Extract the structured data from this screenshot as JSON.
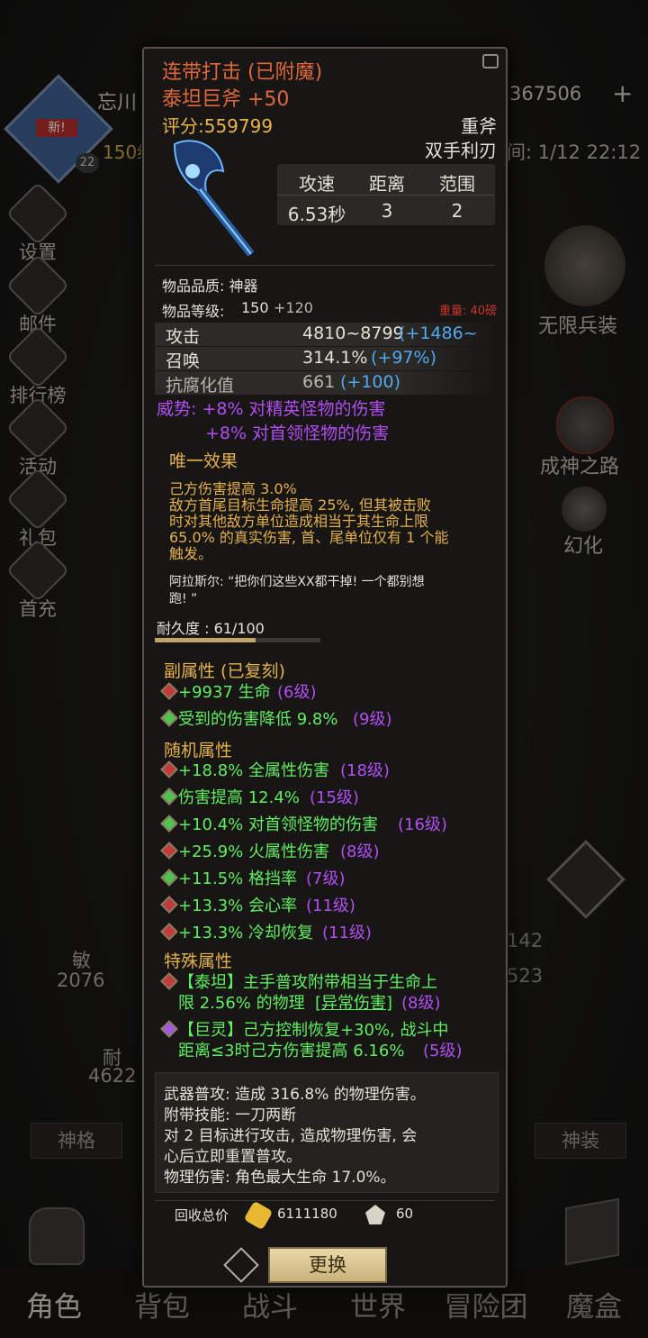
{
  "background": {
    "player_name": "忘川",
    "level_text": "150级",
    "avatar_badge": "新!",
    "avatar_level": "22",
    "currency_partial": "367506",
    "time_text": "间: 1/12 22:12",
    "left_menu": [
      "设置",
      "邮件",
      "排行榜",
      "活动",
      "礼包",
      "首充"
    ],
    "right_menu": [
      "无限兵装",
      "成神之路",
      "幻化"
    ],
    "stats_left": [
      {
        "label": "敏",
        "value": "2076"
      },
      {
        "label": "耐",
        "value": "4622"
      }
    ],
    "stats_right": [
      "142",
      "523"
    ],
    "tabs": {
      "left": "神格",
      "right": "神装"
    },
    "bottom_nav": [
      "角色",
      "背包",
      "战斗",
      "世界",
      "冒险团",
      "魔盒"
    ]
  },
  "item": {
    "enchant_line": "连带打击 (已附魔)",
    "name": "泰坦巨斧 +50",
    "score": "评分:559799",
    "type": "重斧",
    "hand": "双手利刃",
    "stats_table": {
      "headers": [
        "攻速",
        "距离",
        "范围"
      ],
      "values": [
        "6.53秒",
        "3",
        "2"
      ]
    },
    "quality": "物品品质: 神器",
    "item_level_label": "物品等级:",
    "item_level": "150",
    "item_level_bonus": "+120",
    "weight": "重量: 40磅",
    "base_stats": [
      {
        "label": "攻击",
        "value": "4810~8799",
        "bonus": "(+1486~"
      },
      {
        "label": "召唤",
        "value": "314.1%",
        "bonus": "(+97%)"
      },
      {
        "label": "抗腐化值",
        "value": "661",
        "bonus": "(+100)"
      }
    ],
    "power_line1": "威势: +8% 对精英怪物的伤害",
    "power_line2": "+8% 对首领怪物的伤害",
    "unique_title": "唯一效果",
    "unique_text": [
      "己方伤害提高 3.0%",
      "敌方首尾目标生命提高 25%, 但其被击败",
      "时对其他敌方单位造成相当于其生命上限",
      "65.0% 的真实伤害, 首、尾单位仅有 1 个能",
      "触发。"
    ],
    "quote": [
      "阿拉斯尔: “把你们这些XX都干掉! 一个都别想",
      "跑! ”"
    ],
    "durability_text": "耐久度 : 61/100",
    "durability": 0.61,
    "sub_title": "副属性 (已复刻)",
    "sub_attrs": [
      {
        "text": "+9937 生命",
        "lvl": "(6级)",
        "gem": "r"
      },
      {
        "text": "受到的伤害降低 9.8%",
        "lvl": "(9级)",
        "gem": "g"
      }
    ],
    "rand_title": "随机属性",
    "rand_attrs": [
      {
        "text": "+18.8% 全属性伤害",
        "lvl": "(18级)",
        "gem": "r"
      },
      {
        "text": "伤害提高 12.4%",
        "lvl": "(15级)",
        "gem": "g"
      },
      {
        "text": "+10.4% 对首领怪物的伤害",
        "lvl": "(16级)",
        "gem": "g"
      },
      {
        "text": "+25.9% 火属性伤害",
        "lvl": "(8级)",
        "gem": "r"
      },
      {
        "text": "+11.5% 格挡率",
        "lvl": "(7级)",
        "gem": "g"
      },
      {
        "text": "+13.3% 会心率",
        "lvl": "(11级)",
        "gem": "r"
      },
      {
        "text": "+13.3% 冷却恢复",
        "lvl": "(11级)",
        "gem": "r"
      }
    ],
    "special_title": "特殊属性",
    "special1_line1": "【泰坦】主手普攻附带相当于生命上",
    "special1_line2a": "限 2.56% 的物理",
    "special1_link": "[异常伤害]",
    "special1_lvl": "(8级)",
    "special2_line1": "【巨灵】己方控制恢复+30%, 战斗中",
    "special2_line2": "距离≤3时己方伤害提高 6.16%",
    "special2_lvl": "(5级)",
    "skill_text": [
      "武器普攻: 造成 316.8% 的物理伤害。",
      "附带技能: 一刀两断",
      "对 2 目标进行攻击, 造成物理伤害, 会",
      "心后立即重置普攻。",
      "物理伤害: 角色最大生命 17.0%。"
    ],
    "recycle_label": "回收总价",
    "recycle_gold": "6111180",
    "recycle_shard": "60",
    "swap_button": "更换"
  }
}
